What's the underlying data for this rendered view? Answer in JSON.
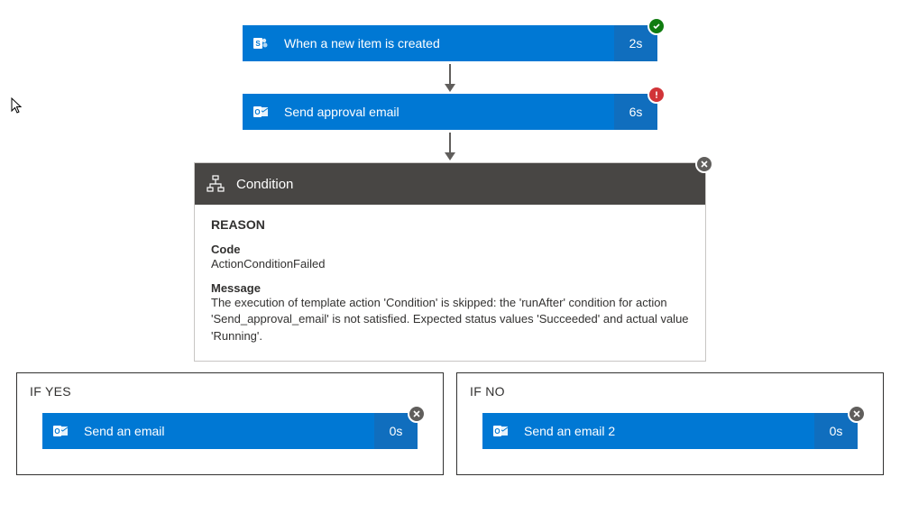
{
  "steps": {
    "trigger": {
      "label": "When a new item is created",
      "duration": "2s",
      "status": "success"
    },
    "approval": {
      "label": "Send approval email",
      "duration": "6s",
      "status": "error"
    }
  },
  "condition": {
    "title": "Condition",
    "status": "skipped",
    "reason_heading": "REASON",
    "code_label": "Code",
    "code_value": "ActionConditionFailed",
    "message_label": "Message",
    "message_value": "The execution of template action 'Condition' is skipped: the 'runAfter' condition for action 'Send_approval_email' is not satisfied. Expected status values 'Succeeded' and actual value 'Running'."
  },
  "branches": {
    "yes": {
      "label": "IF YES",
      "step": {
        "label": "Send an email",
        "duration": "0s",
        "status": "skipped"
      }
    },
    "no": {
      "label": "IF NO",
      "step": {
        "label": "Send an email 2",
        "duration": "0s",
        "status": "skipped"
      }
    }
  }
}
